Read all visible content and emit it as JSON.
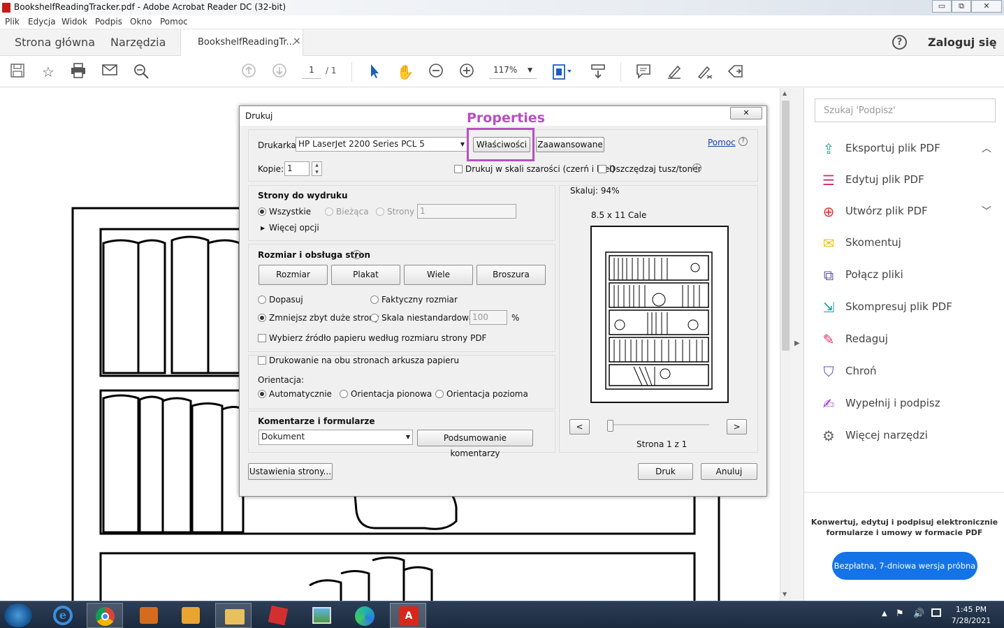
{
  "window": {
    "title": "BookshelfReadingTracker.pdf - Adobe Acrobat Reader DC (32-bit)",
    "min": "▭",
    "max": "⧉",
    "close": "✕"
  },
  "menu": [
    "Plik",
    "Edycja",
    "Widok",
    "Podpis",
    "Okno",
    "Pomoc"
  ],
  "tabs": {
    "home": "Strona główna",
    "tools": "Narzędzia",
    "doc": "BookshelfReadingTr...",
    "doc_close": "×",
    "help_icon": "?",
    "login": "Zaloguj się"
  },
  "toolbar": {
    "page_current": "1",
    "page_total": "/ 1",
    "zoom": "117%"
  },
  "annotation": {
    "label": "Properties",
    "color": "#b550c0"
  },
  "dialog": {
    "title": "Drukuj",
    "close": "✕",
    "printer_label": "Drukarka:",
    "printer_value": "HP LaserJet 2200 Series PCL 5",
    "properties_btn": "Właściwości",
    "advanced_btn": "Zaawansowane",
    "help_link": "Pomoc",
    "copies_label": "Kopie:",
    "copies_value": "1",
    "grayscale_label": "Drukuj w skali szarości (czerń i biel)",
    "save_ink_label": "Oszczędzaj tusz/toner",
    "pages_title": "Strony do wydruku",
    "pages_all": "Wszystkie",
    "pages_current": "Bieżąca",
    "pages_range": "Strony",
    "pages_range_value": "1",
    "more_options": "Więcej opcji",
    "size_title": "Rozmiar i obsługa stron",
    "size_btn": "Rozmiar",
    "poster_btn": "Plakat",
    "multiple_btn": "Wiele",
    "booklet_btn": "Broszura",
    "fit": "Dopasuj",
    "actual_size": "Faktyczny rozmiar",
    "shrink": "Zmniejsz zbyt duże strony",
    "custom_scale": "Skala niestandardowa:",
    "custom_scale_value": "100",
    "percent": "%",
    "paper_source": "Wybierz źródło papieru według rozmiaru strony PDF",
    "duplex": "Drukowanie na obu stronach arkusza papieru",
    "orientation_label": "Orientacja:",
    "orient_auto": "Automatycznie",
    "orient_portrait": "Orientacja pionowa",
    "orient_landscape": "Orientacja pozioma",
    "comments_title": "Komentarze i formularze",
    "comments_value": "Dokument",
    "summarize_btn": "Podsumowanie komentarzy",
    "page_setup_btn": "Ustawienia strony...",
    "scale_label": "Skaluj:  94%",
    "paper_size": "8.5 x 11 Cale",
    "prev": "<",
    "next": ">",
    "page_info": "Strona 1 z 1",
    "print_btn": "Druk",
    "cancel_btn": "Anuluj"
  },
  "right_panel": {
    "search_placeholder": "Szukaj 'Podpisz'",
    "items": [
      {
        "label": "Eksportuj plik PDF",
        "color": "#2a9d8f"
      },
      {
        "label": "Edytuj plik PDF",
        "color": "#d6336c"
      },
      {
        "label": "Utwórz plik PDF",
        "color": "#e03131"
      },
      {
        "label": "Skomentuj",
        "color": "#f2c200"
      },
      {
        "label": "Połącz pliki",
        "color": "#5c4fc7"
      },
      {
        "label": "Skompresuj plik PDF",
        "color": "#1c9c9c"
      },
      {
        "label": "Redaguj",
        "color": "#d6336c"
      },
      {
        "label": "Chroń",
        "color": "#5c4fc7"
      },
      {
        "label": "Wypełnij i podpisz",
        "color": "#9b3fc7"
      },
      {
        "label": "Więcej narzędzi",
        "color": "#666666"
      }
    ],
    "promo_text": "Konwertuj, edytuj i podpisuj elektronicznie formularze i umowy w formacie PDF",
    "trial_btn": "Bezpłatna, 7-dniowa wersja próbna"
  },
  "taskbar": {
    "time": "1:45 PM",
    "date": "7/28/2021"
  }
}
